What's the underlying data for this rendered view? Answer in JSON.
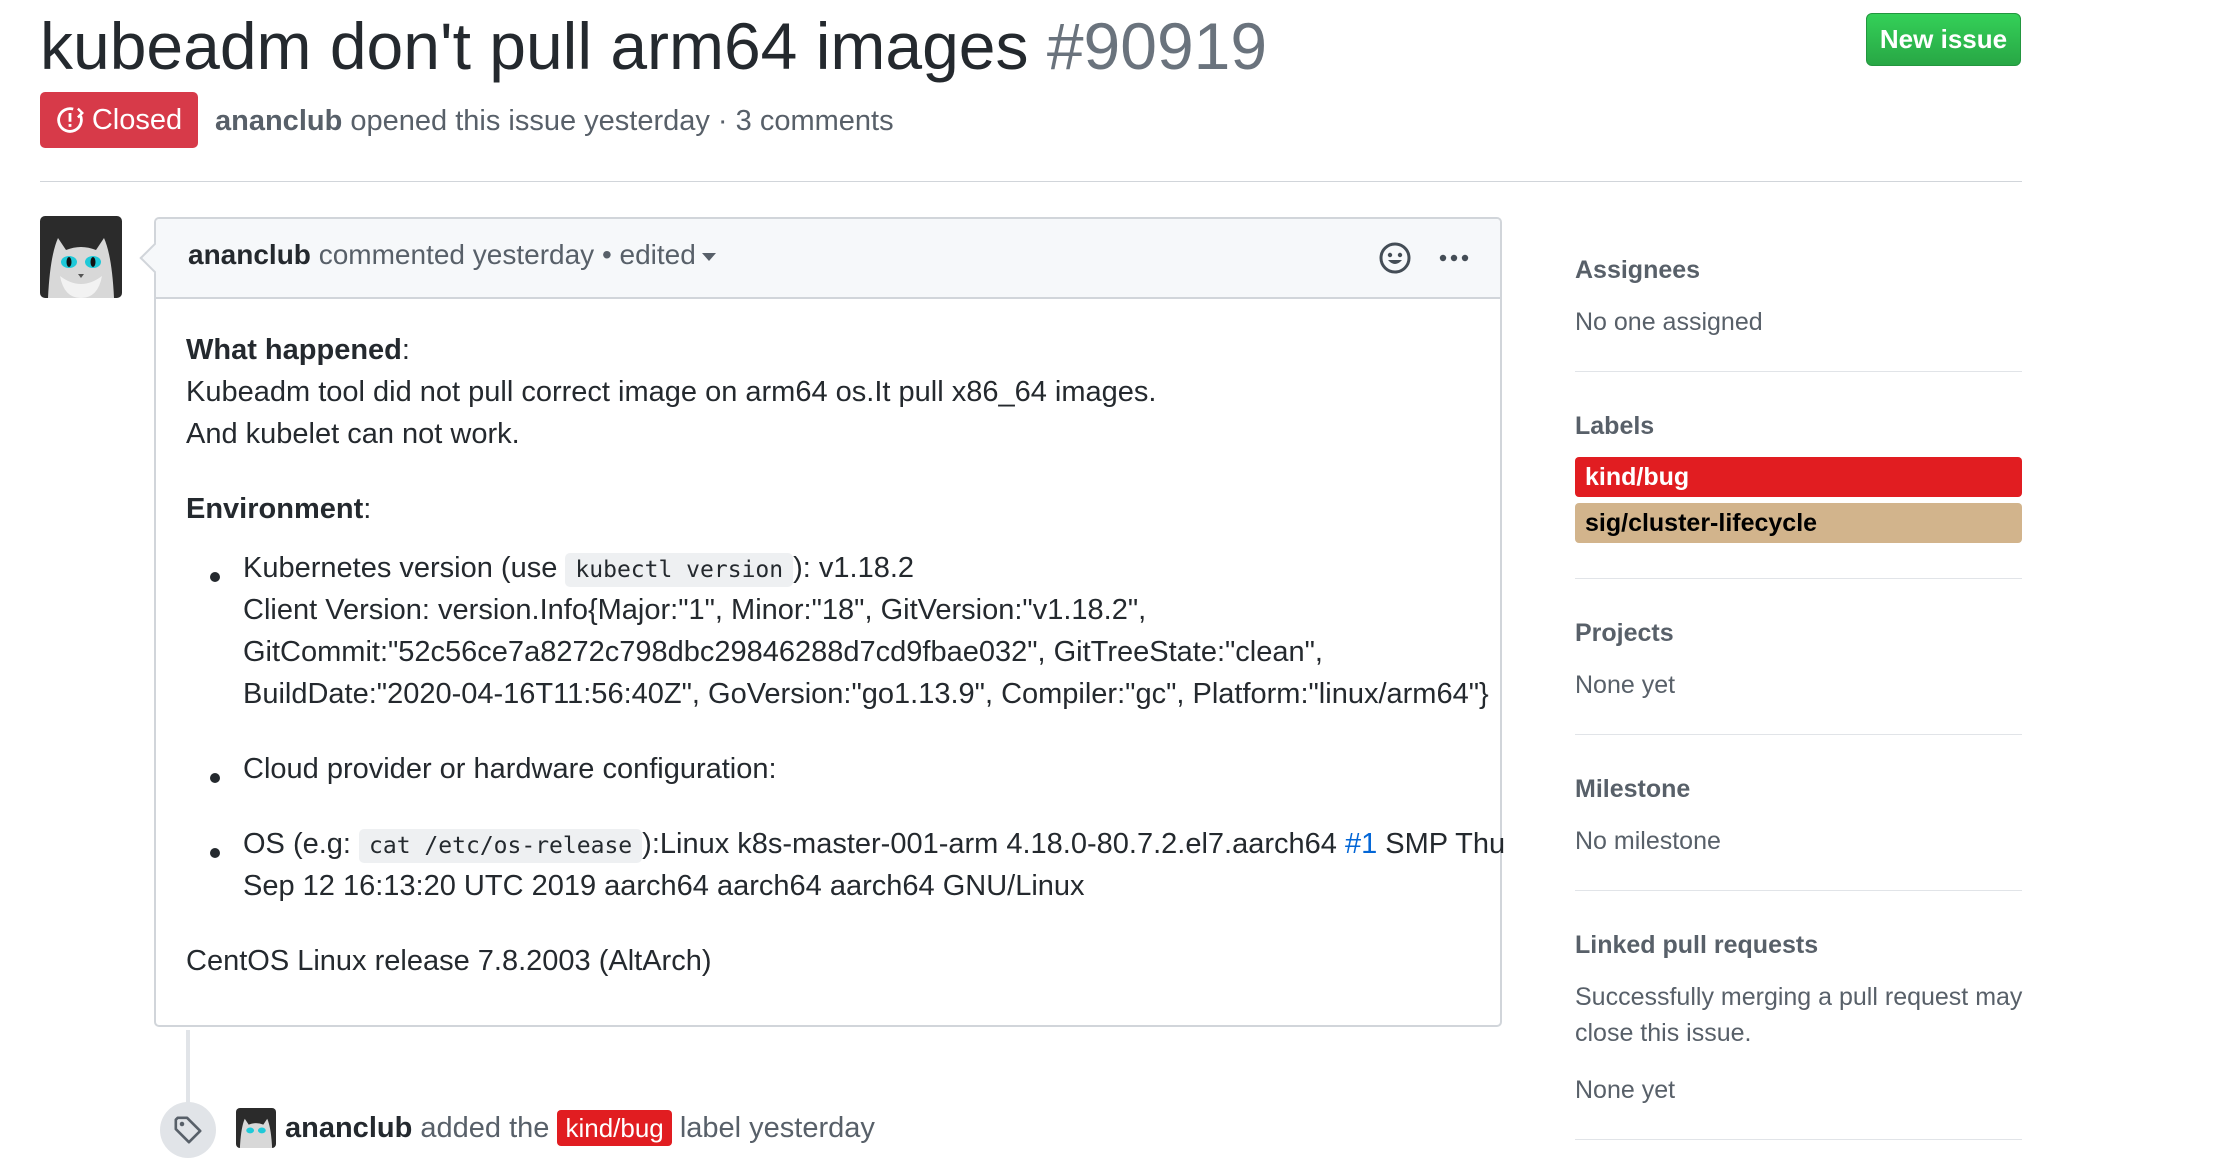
{
  "issue": {
    "title": "kubeadm don't pull arm64 images",
    "number": "#90919",
    "state": "Closed",
    "author": "ananclub",
    "opened_text": "opened this issue yesterday · 3 comments",
    "new_issue_label": "New issue"
  },
  "comment": {
    "author": "ananclub",
    "meta": "commented yesterday • edited",
    "what_happened_label": "What happened",
    "what_happened_lines": [
      "Kubeadm tool did not pull correct image on arm64 os.It pull x86_64 images.",
      "And kubelet can not work."
    ],
    "environment_label": "Environment",
    "k8s_prefix": "Kubernetes version (use ",
    "k8s_code": "kubectl version",
    "k8s_suffix": "): v1.18.2",
    "client_version_lines": [
      "Client Version: version.Info{Major:\"1\", Minor:\"18\", GitVersion:\"v1.18.2\",",
      "GitCommit:\"52c56ce7a8272c798dbc29846288d7cd9fbae032\", GitTreeState:\"clean\",",
      "BuildDate:\"2020-04-16T11:56:40Z\", GoVersion:\"go1.13.9\", Compiler:\"gc\", Platform:\"linux/arm64\"}"
    ],
    "cloud_provider": "Cloud provider or hardware configuration:",
    "os_prefix": "OS (e.g: ",
    "os_code": "cat /etc/os-release",
    "os_suffix": "):Linux k8s-master-001-arm 4.18.0-80.7.2.el7.aarch64 ",
    "os_link": "#1",
    "os_suffix2": " SMP Thu",
    "os_line2": "Sep 12 16:13:20 UTC 2019 aarch64 aarch64 aarch64 GNU/Linux",
    "centos": "CentOS Linux release 7.8.2003 (AltArch)"
  },
  "event": {
    "actor": "ananclub",
    "added_text": "added the",
    "label": "kind/bug",
    "suffix": "label yesterday"
  },
  "sidebar": {
    "assignees_title": "Assignees",
    "assignees_value": "No one assigned",
    "labels_title": "Labels",
    "labels": [
      {
        "name": "kind/bug",
        "color": "#e11d21",
        "text_color": "#ffffff"
      },
      {
        "name": "sig/cluster-lifecycle",
        "color": "#d2b48c",
        "text_color": "#000000"
      }
    ],
    "projects_title": "Projects",
    "projects_value": "None yet",
    "milestone_title": "Milestone",
    "milestone_value": "No milestone",
    "linked_title": "Linked pull requests",
    "linked_desc_1": "Successfully merging a pull request may",
    "linked_desc_2": "close this issue.",
    "linked_value": "None yet"
  }
}
